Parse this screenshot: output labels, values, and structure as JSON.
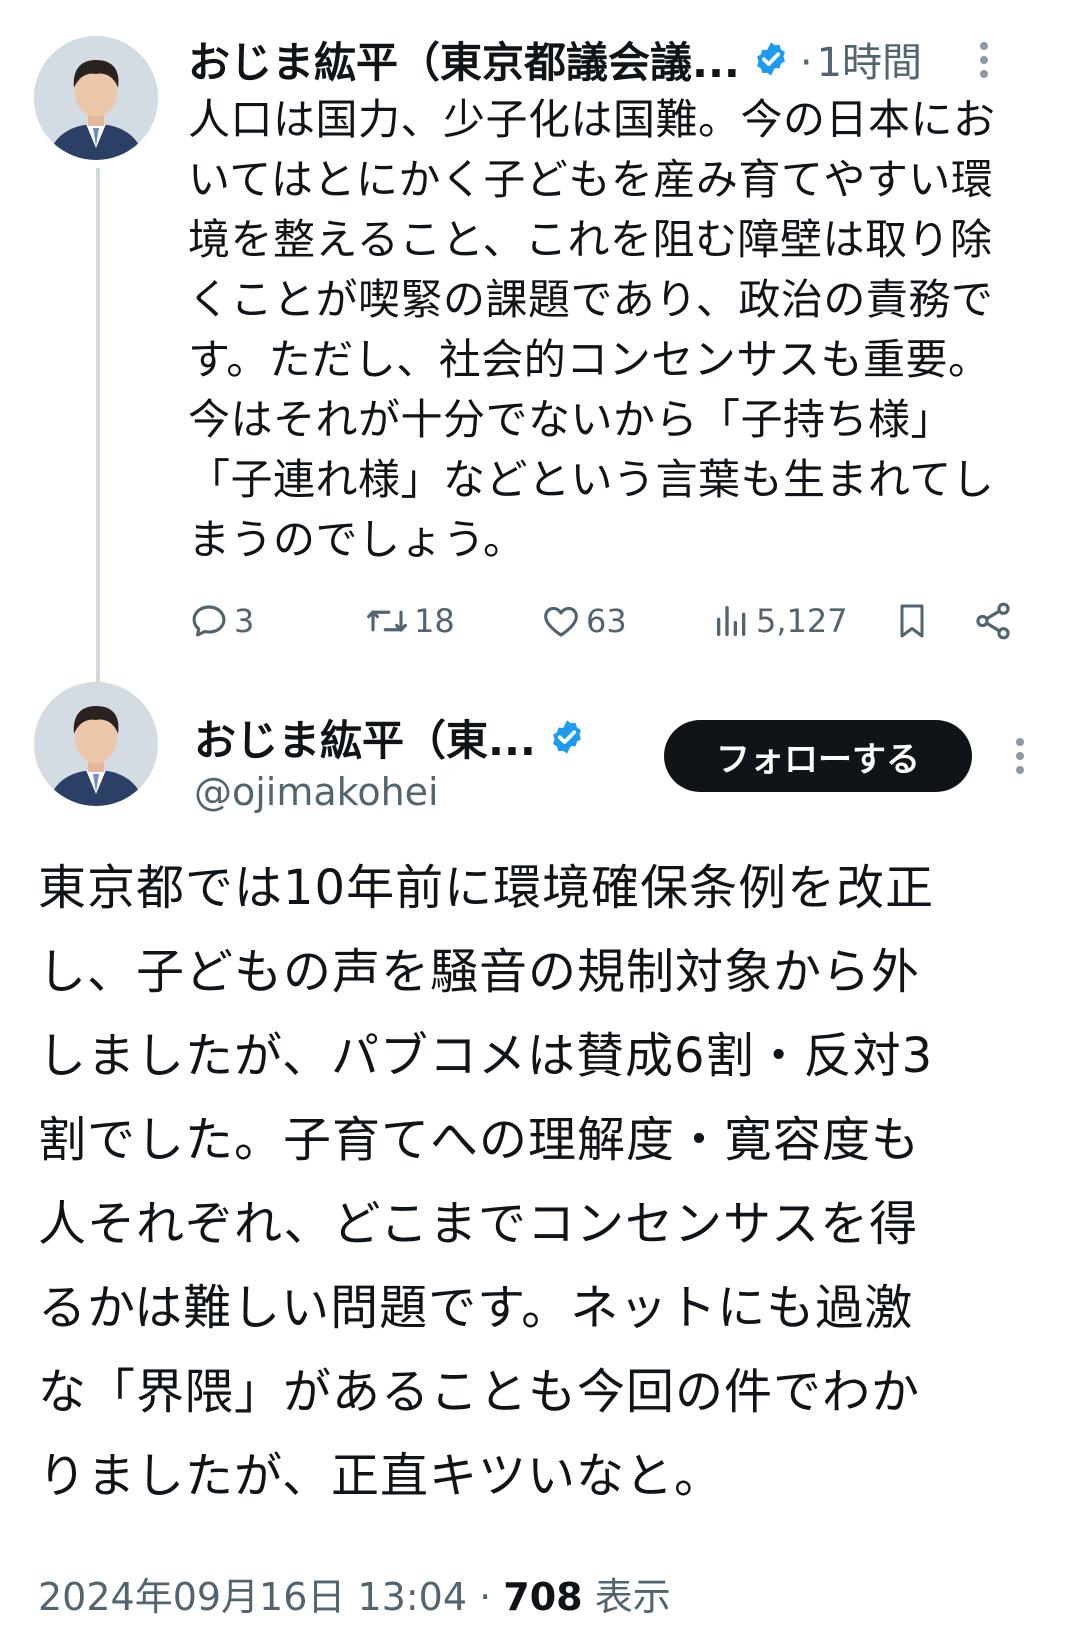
{
  "tweet1": {
    "author_name": "おじま紘平（東京都議会議...",
    "separator": "·",
    "time": "1時間",
    "text": "人口は国力、少子化は国難。今の日本にお\nいてはとにかく子どもを産み育てやすい環\n境を整えること、これを阻む障壁は取り除\nくことが喫緊の課題であり、政治の責務で\nす。ただし、社会的コンセンサスも重要。\n今はそれが十分でないから「子持ち様」\n「子連れ様」などという言葉も生まれてし\nまうのでしょう。",
    "stats": {
      "replies": "3",
      "retweets": "18",
      "likes": "63",
      "views": "5,127"
    }
  },
  "tweet2": {
    "author_name": "おじま紘平（東...",
    "handle": "@ojimakohei",
    "follow_label": "フォローする",
    "text": "東京都では10年前に環境確保条例を改正\nし、子どもの声を騒音の規制対象から外\nしましたが、パブコメは賛成6割・反対3\n割でした。子育てへの理解度・寛容度も\n人それぞれ、どこまでコンセンサスを得\nるかは難しい問題です。ネットにも過激\nな「界隈」があることも今回の件でわか\nりましたが、正直キツいなと。",
    "timestamp": "2024年09月16日 13:04",
    "separator": "·",
    "view_count": "708",
    "view_label": "表示"
  },
  "colors": {
    "verified_blue": "#1d9bf0",
    "text_secondary": "#536471",
    "follow_bg": "#0f1419",
    "thread_line": "#cfd9de"
  },
  "icons": {
    "verified": "verified-badge-icon",
    "more": "more-options-icon",
    "reply": "reply-icon",
    "retweet": "retweet-icon",
    "like": "heart-icon",
    "views": "views-chart-icon",
    "bookmark": "bookmark-icon",
    "share": "share-icon"
  }
}
